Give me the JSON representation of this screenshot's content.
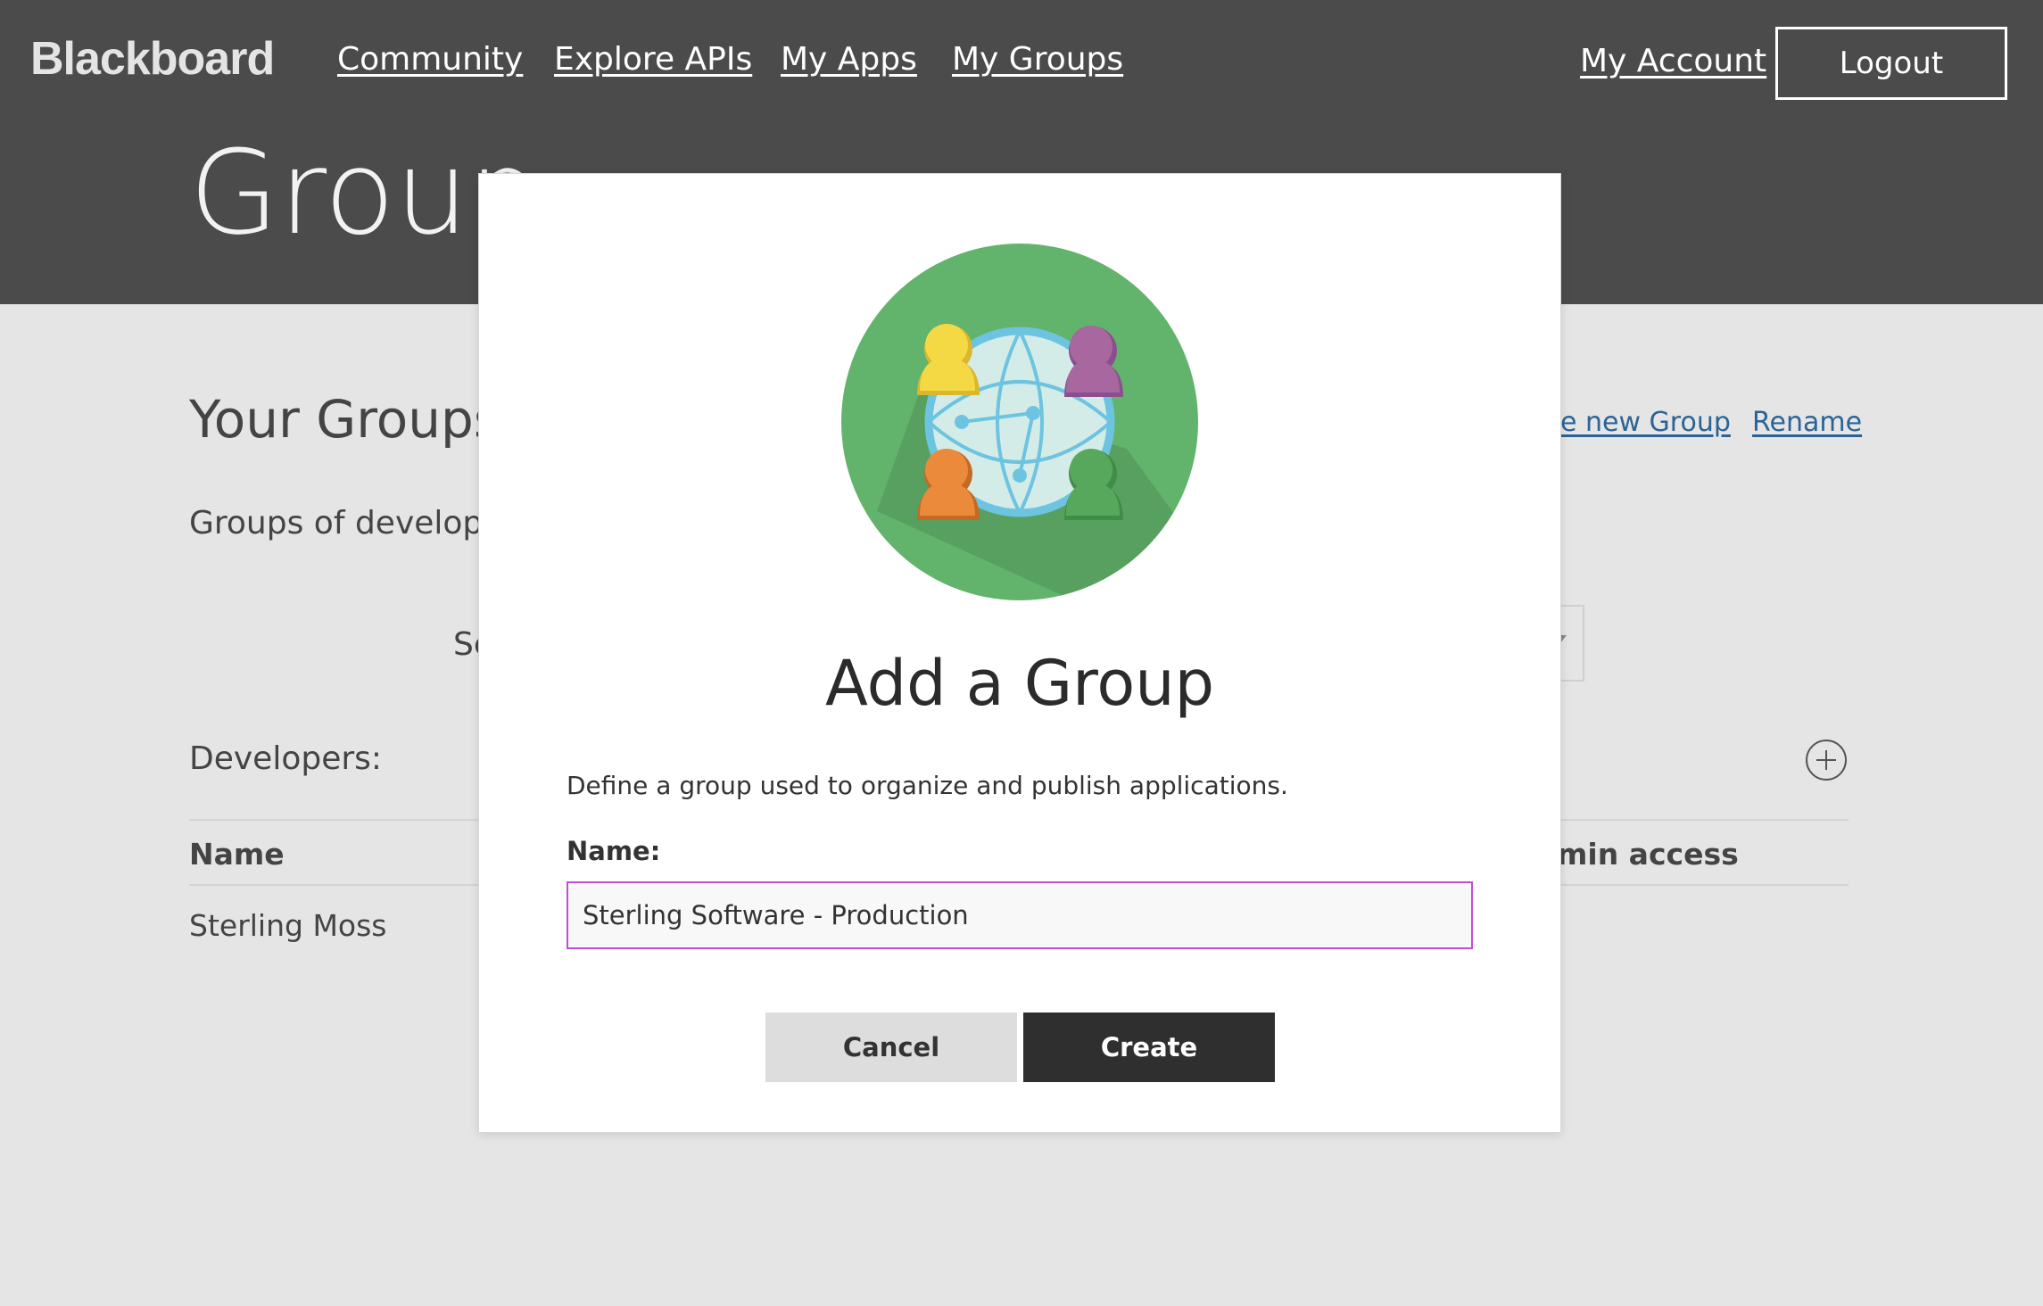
{
  "header": {
    "logo": "Blackboard",
    "nav": [
      "Community",
      "Explore APIs",
      "My Apps",
      "My Groups"
    ],
    "my_account": "My Account",
    "logout": "Logout",
    "page_title": "Group"
  },
  "background": {
    "section_title": "Your Groups",
    "description": "Groups of develope",
    "select_label": "Se",
    "create_group_link": "e new Group",
    "rename_link": "Rename",
    "developers_label": "Developers:",
    "columns": [
      "Name",
      "min access"
    ],
    "rows": [
      {
        "name": "Sterling Moss"
      }
    ]
  },
  "modal": {
    "title": "Add a Group",
    "description": "Define a group used to organize and publish applications.",
    "name_label": "Name:",
    "name_value": "Sterling Software - Production",
    "cancel": "Cancel",
    "create": "Create",
    "icon": "group-globe-icon"
  },
  "colors": {
    "header_bg": "#4b4b4b",
    "page_bg": "#e5e5e5",
    "icon_green": "#62b36b",
    "input_focus": "#c14fd4",
    "create_bg": "#2f2f2f",
    "link": "#2a6496"
  }
}
